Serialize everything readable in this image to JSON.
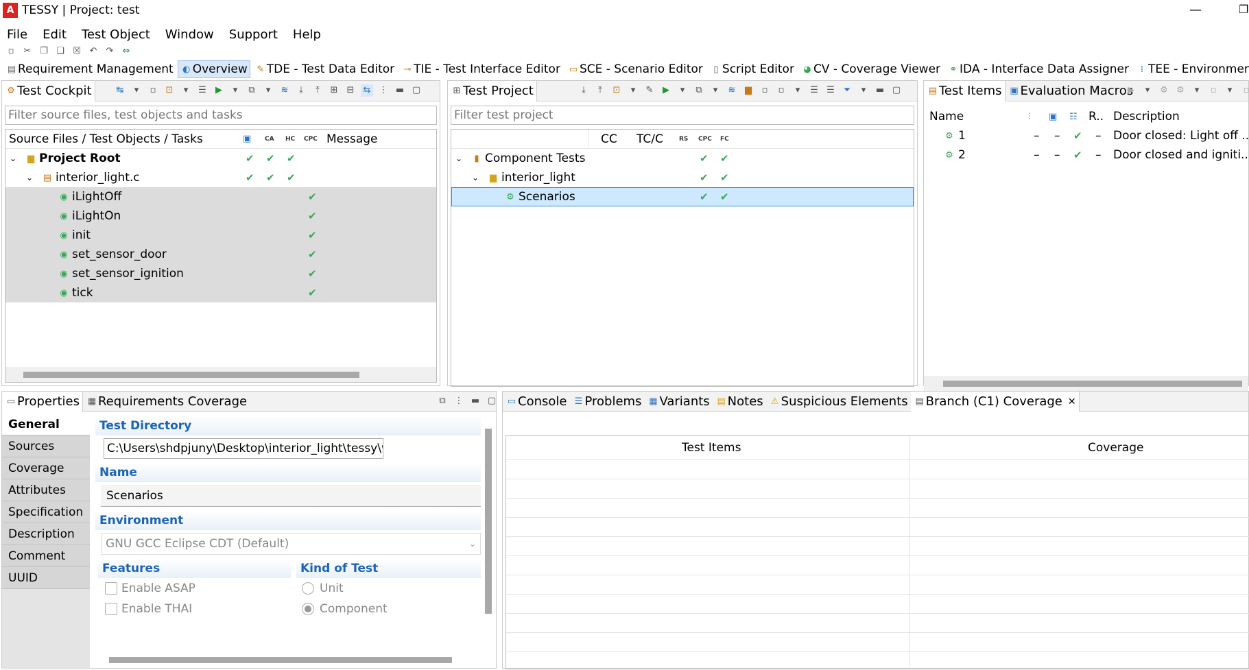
{
  "window": {
    "title": "TESSY | Project: test"
  },
  "menu": [
    "File",
    "Edit",
    "Test Object",
    "Window",
    "Support",
    "Help"
  ],
  "perspectives": [
    {
      "label": "Requirement Management",
      "icon": "requirement-icon"
    },
    {
      "label": "Overview",
      "icon": "overview-icon",
      "active": true
    },
    {
      "label": "TDE - Test Data Editor",
      "icon": "tde-icon"
    },
    {
      "label": "TIE - Test Interface Editor",
      "icon": "tie-icon"
    },
    {
      "label": "SCE - Scenario Editor",
      "icon": "sce-icon"
    },
    {
      "label": "Script Editor",
      "icon": "script-icon"
    },
    {
      "label": "CV - Coverage Viewer",
      "icon": "coverage-icon"
    },
    {
      "label": "IDA - Interface Data Assigner",
      "icon": "ida-icon"
    },
    {
      "label": "TEE - Environment Editor",
      "icon": "tee-icon"
    }
  ],
  "cockpit": {
    "tab": "Test Cockpit",
    "filter_placeholder": "Filter source files, test objects and tasks",
    "columns": {
      "name": "Source Files / Test Objects / Tasks",
      "ca": "CA",
      "hc": "HC",
      "cpc": "CPC",
      "message": "Message"
    },
    "root": {
      "label": "Project Root"
    },
    "file": {
      "label": "interior_light.c"
    },
    "functions": [
      "iLightOff",
      "iLightOn",
      "init",
      "set_sensor_door",
      "set_sensor_ignition",
      "tick"
    ]
  },
  "project": {
    "tab": "Test Project",
    "filter_placeholder": "Filter test project",
    "columns": {
      "cc": "CC",
      "tcc": "TC/C",
      "rs": "RS",
      "cpc": "CPC",
      "fc": "FC"
    },
    "rows": [
      "Component Tests",
      "interior_light",
      "Scenarios"
    ]
  },
  "items": {
    "tabs": [
      "Test Items",
      "Evaluation Macros"
    ],
    "columns": {
      "name": "Name",
      "r": "R..",
      "description": "Description"
    },
    "dash": "–",
    "rows": [
      {
        "name": "1",
        "description": "Door closed: Light off ..."
      },
      {
        "name": "2",
        "description": "Door closed and igniti..."
      }
    ]
  },
  "properties": {
    "tabs": [
      "Properties",
      "Requirements Coverage"
    ],
    "side_tabs": [
      "General",
      "Sources",
      "Coverage",
      "Attributes",
      "Specification",
      "Description",
      "Comment",
      "UUID"
    ],
    "test_directory_label": "Test Directory",
    "test_directory_value": "C:\\Users\\shdpjuny\\Desktop\\interior_light\\tessy\\wo",
    "name_label": "Name",
    "name_value": "Scenarios",
    "environment_label": "Environment",
    "environment_value": "GNU GCC Eclipse CDT (Default)",
    "features_label": "Features",
    "features": [
      "Enable ASAP",
      "Enable THAI"
    ],
    "kind_label": "Kind of Test",
    "kinds": [
      "Unit",
      "Component"
    ],
    "kind_selected": "Component"
  },
  "bottom": {
    "tabs": [
      "Console",
      "Problems",
      "Variants",
      "Notes",
      "Suspicious Elements",
      "Branch (C1) Coverage"
    ],
    "close": "✕",
    "columns": [
      "Test Items",
      "Coverage"
    ]
  },
  "colors": {
    "accent": "#1a63b6",
    "check": "#3aa757",
    "selection": "#cde8ff"
  }
}
